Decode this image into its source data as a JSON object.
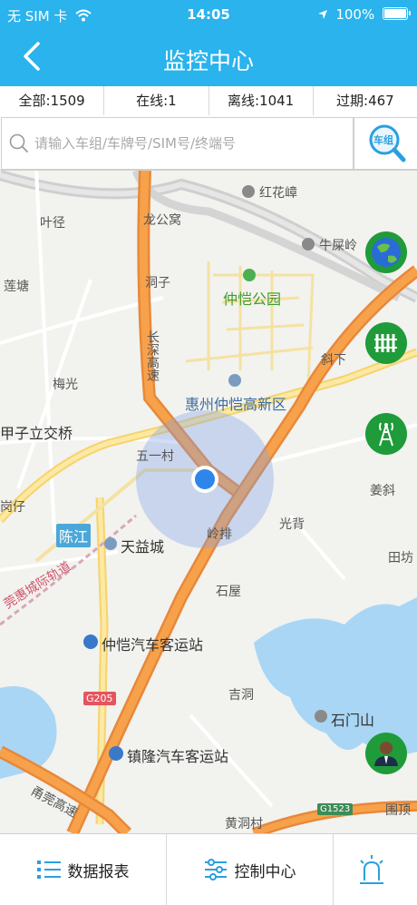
{
  "status_bar": {
    "carrier": "无 SIM 卡",
    "time": "14:05",
    "battery": "100%"
  },
  "nav": {
    "title": "监控中心"
  },
  "stats": [
    {
      "label": "全部:1509"
    },
    {
      "label": "在线:1"
    },
    {
      "label": "离线:1041"
    },
    {
      "label": "过期:467"
    }
  ],
  "search": {
    "placeholder": "请输入车组/车牌号/SIM号/终端号",
    "group_button": "车组"
  },
  "map": {
    "labels": {
      "honghuazhang": "红花嶂",
      "longgongwo": "龙公窝",
      "yejing": "叶径",
      "niushiling": "牛屎岭",
      "liantang": "莲塘",
      "dongzi": "洞子",
      "zhongkai_park": "仲恺公园",
      "changshen": "长深高速",
      "xiexia": "斜下",
      "meiguang": "梅光",
      "zhongkai_hitech": "惠州仲恺高新区",
      "jiaqiao": "甲子立交桥",
      "wuyicun": "五一村",
      "jiangxie": "姜斜",
      "gangzi": "岗仔",
      "chenjiang": "陈江",
      "tianyicheng": "天益城",
      "lingpai": "岭排",
      "guangbei": "光背",
      "tianfang": "田坊",
      "rail": "莞惠城际轨道",
      "shiwu": "石屋",
      "bus_station_1": "仲恺汽车客运站",
      "g205": "G205",
      "jidong": "吉洞",
      "shimenshan": "石门山",
      "bus_station_2": "镇隆汽车客运站",
      "guanguan": "甬莞高速",
      "g1523": "G1523",
      "huangdongcun": "黄洞村",
      "weiding": "围顶"
    }
  },
  "tabs": {
    "report": "数据报表",
    "control": "控制中心"
  },
  "colors": {
    "primary": "#2ab3ec",
    "highway": "#f39a2b",
    "vehicle": "#2f86ea"
  }
}
